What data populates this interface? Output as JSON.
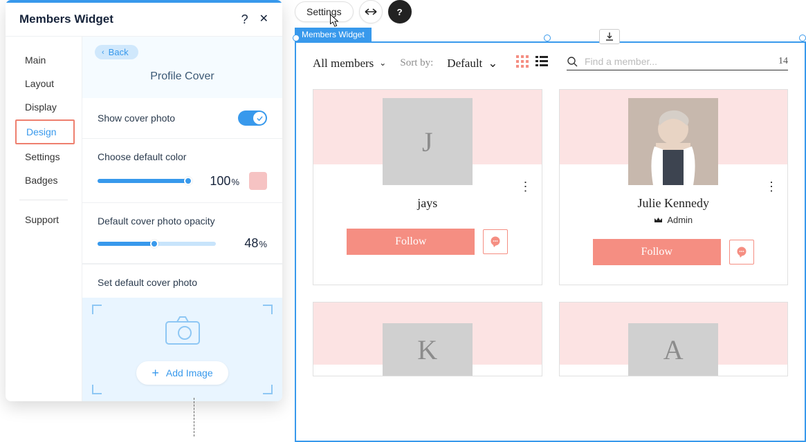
{
  "panel": {
    "title": "Members Widget",
    "nav": {
      "items": [
        "Main",
        "Layout",
        "Display",
        "Design",
        "Settings",
        "Badges"
      ],
      "support": "Support",
      "active_index": 3
    },
    "back_label": "Back",
    "section_title": "Profile Cover",
    "show_cover": {
      "label": "Show cover photo",
      "value": true
    },
    "default_color": {
      "label": "Choose default color",
      "value": 100,
      "unit": "%",
      "swatch": "#f6c3c3"
    },
    "opacity": {
      "label": "Default cover photo opacity",
      "value": 48,
      "unit": "%"
    },
    "upload": {
      "label": "Set default cover photo",
      "button": "Add Image"
    }
  },
  "floatbar": {
    "settings": "Settings",
    "widget_tag": "Members Widget"
  },
  "widget": {
    "all_members": "All members",
    "sort_label": "Sort by:",
    "sort_value": "Default",
    "search_placeholder": "Find a member...",
    "count": "14",
    "follow_label": "Follow",
    "members": [
      {
        "initial": "J",
        "name": "jays",
        "role": null,
        "has_photo": false
      },
      {
        "initial": "",
        "name": "Julie Kennedy",
        "role": "Admin",
        "has_photo": true
      },
      {
        "initial": "K",
        "name": "",
        "role": null,
        "has_photo": false
      },
      {
        "initial": "A",
        "name": "",
        "role": null,
        "has_photo": false
      }
    ]
  }
}
